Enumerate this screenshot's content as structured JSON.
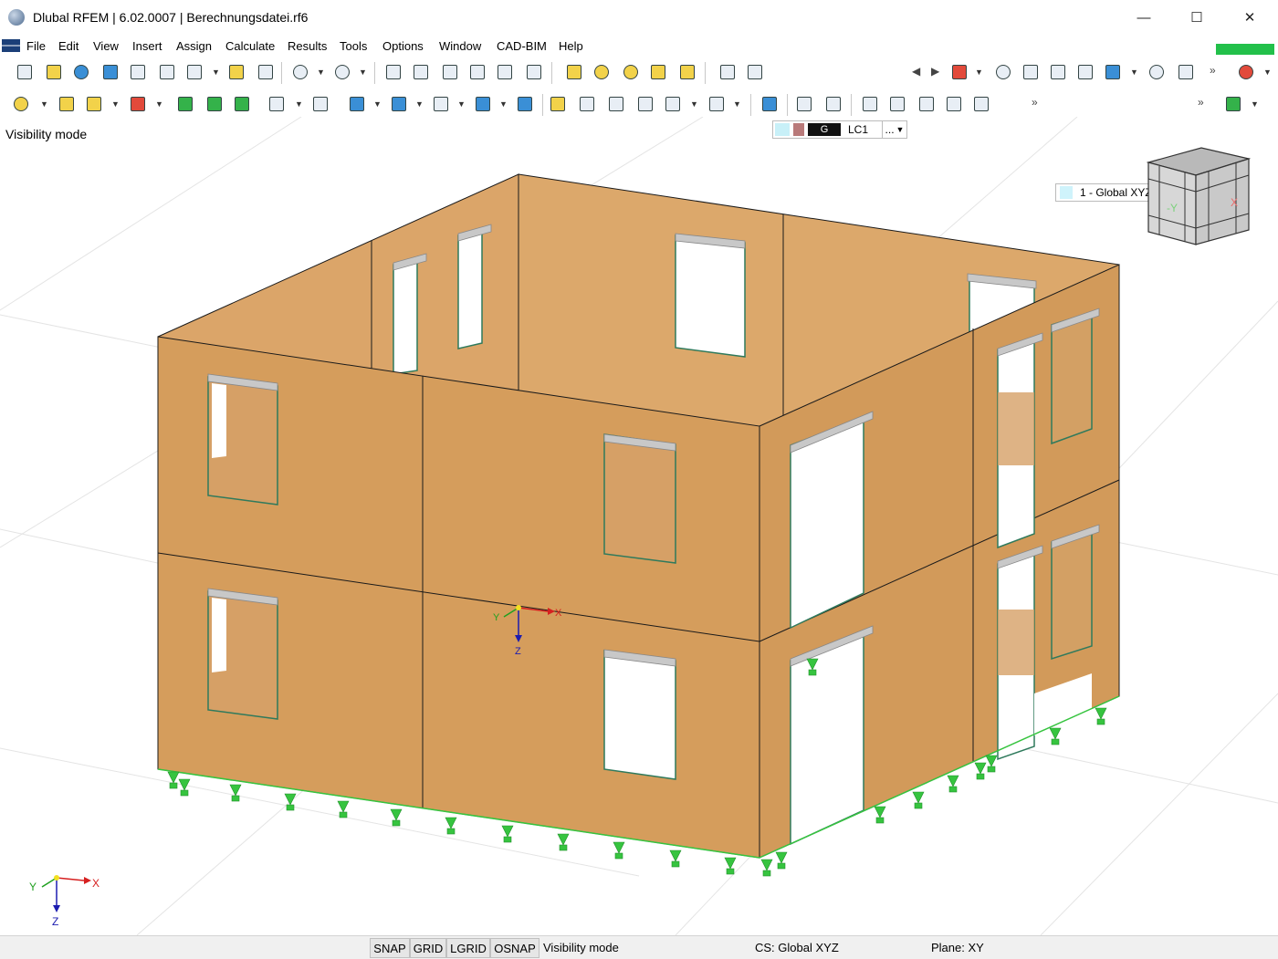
{
  "window": {
    "title": "Dlubal RFEM | 6.02.0007 | Berechnungsdatei.rf6",
    "minimize": "—",
    "maximize": "☐",
    "close": "✕"
  },
  "menu": [
    "File",
    "Edit",
    "View",
    "Insert",
    "Assign",
    "Calculate",
    "Results",
    "Tools",
    "Options",
    "Window",
    "CAD-BIM",
    "Help"
  ],
  "toolbar": {
    "lc_type": "G",
    "lc_name": "LC1",
    "lc_more": "...",
    "cs_select": "1 - Global XYZ"
  },
  "viewport": {
    "mode_label": "Visibility mode",
    "axis_x": "X",
    "axis_y": "Y",
    "axis_z": "Z",
    "navcube_minus_y": "-Y",
    "navcube_x": "X"
  },
  "statusbar": {
    "snap": "SNAP",
    "grid": "GRID",
    "lgrid": "LGRID",
    "osnap": "OSNAP",
    "mode": "Visibility mode",
    "cs": "CS: Global XYZ",
    "plane": "Plane: XY"
  },
  "colors": {
    "wall_front": "#d59d5c",
    "wall_inner": "#dca86b",
    "support": "#36c43f",
    "lintel": "#c8c8c8",
    "accent_green": "#22c04a"
  }
}
